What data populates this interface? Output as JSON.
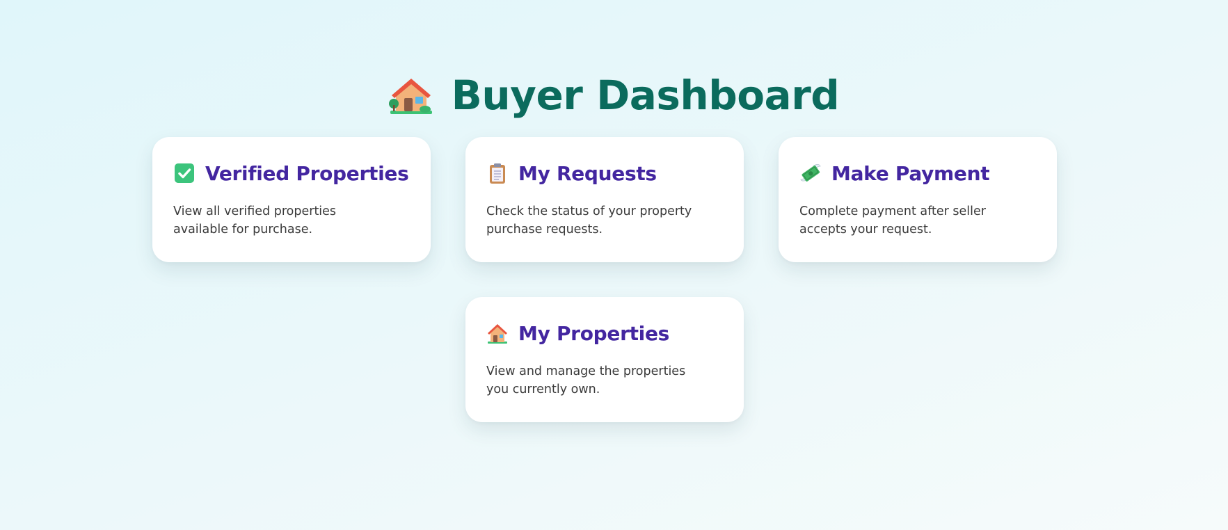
{
  "header": {
    "icon": "house-with-garden-icon",
    "title": "Buyer Dashboard"
  },
  "colors": {
    "title": "#0b6b5d",
    "card_title": "#4326a0",
    "card_text": "#3a3a3a",
    "card_bg": "#ffffff"
  },
  "cards": [
    {
      "icon": "check-mark-button-icon",
      "title": "Verified Properties",
      "description": "View all verified properties available for purchase."
    },
    {
      "icon": "clipboard-icon",
      "title": "My Requests",
      "description": "Check the status of your property purchase requests."
    },
    {
      "icon": "money-with-wings-icon",
      "title": "Make Payment",
      "description": "Complete payment after seller accepts your request."
    },
    {
      "icon": "house-icon",
      "title": "My Properties",
      "description": "View and manage the properties you currently own."
    }
  ]
}
